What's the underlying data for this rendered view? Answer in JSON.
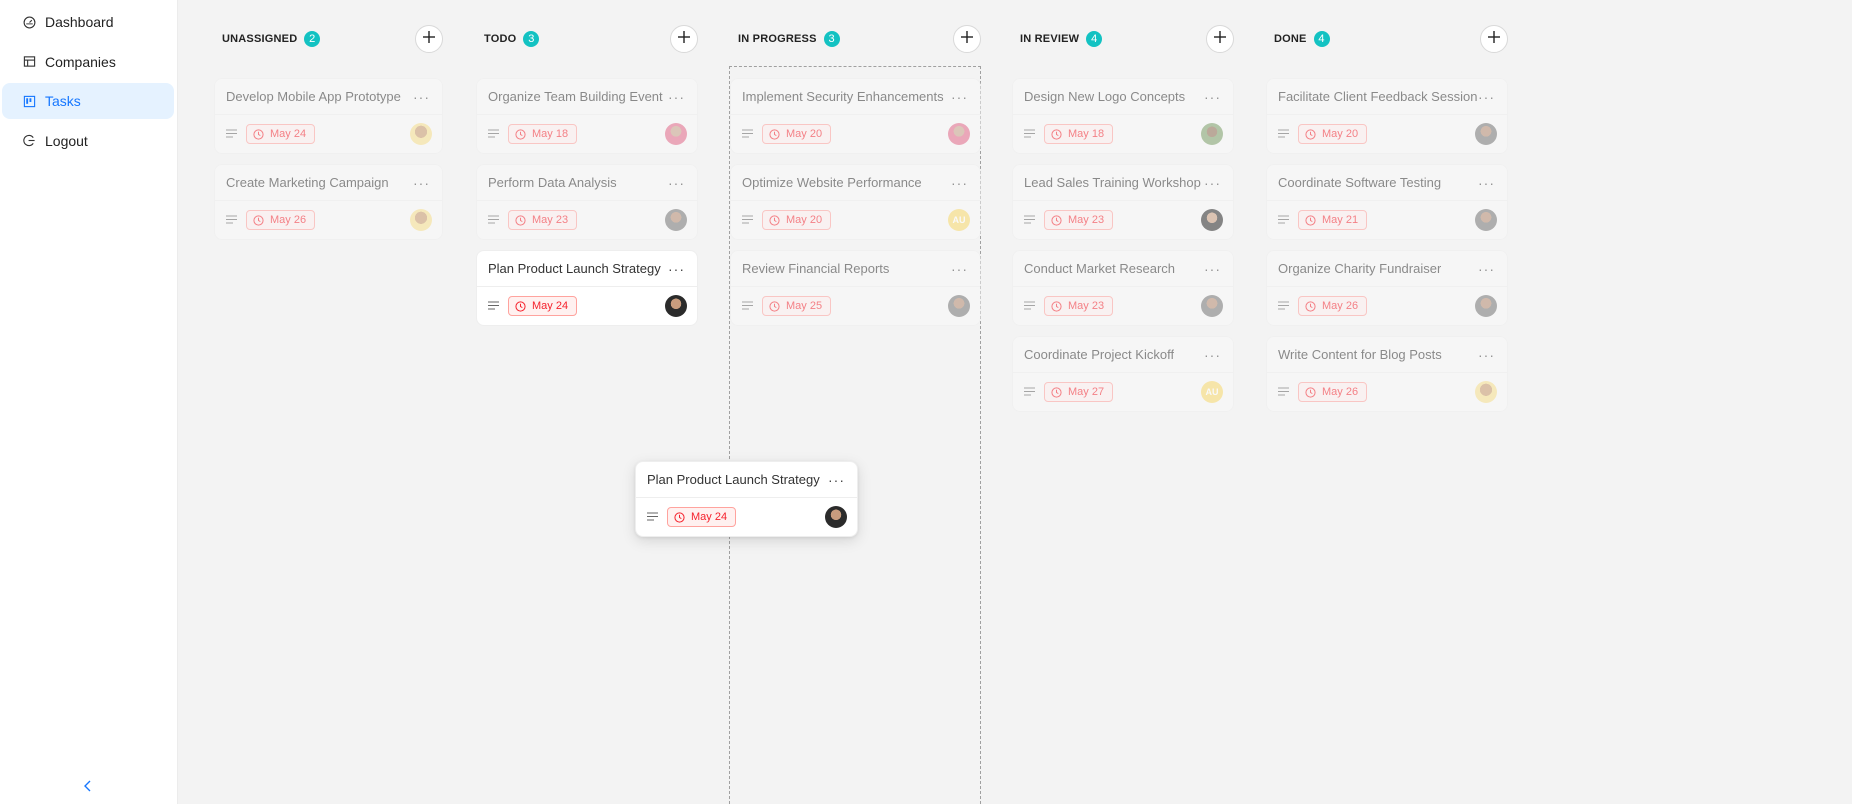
{
  "sidebar": {
    "items": [
      {
        "label": "Dashboard",
        "icon": "dashboard-icon",
        "active": false
      },
      {
        "label": "Companies",
        "icon": "shop-icon",
        "active": false
      },
      {
        "label": "Tasks",
        "icon": "project-board-icon",
        "active": true
      },
      {
        "label": "Logout",
        "icon": "logout-icon",
        "active": false
      }
    ],
    "collapse_icon": "chevron-left-icon"
  },
  "colors": {
    "accent": "#1677ff",
    "count_badge": "#13c2c2",
    "due_date": "#f5222d"
  },
  "columns": [
    {
      "title": "UNASSIGNED",
      "count": "2",
      "cards": [
        {
          "title": "Develop Mobile App Prototype",
          "date": "May 24",
          "avatar": "yellow-photo"
        },
        {
          "title": "Create Marketing Campaign",
          "date": "May 26",
          "avatar": "yellow-photo"
        }
      ]
    },
    {
      "title": "TODO",
      "count": "3",
      "cards": [
        {
          "title": "Organize Team Building Event",
          "date": "May 18",
          "avatar": "pink-photo"
        },
        {
          "title": "Perform Data Analysis",
          "date": "May 23",
          "avatar": "gray-photo"
        },
        {
          "title": "Plan Product Launch Strategy",
          "date": "May 24",
          "avatar": "dark-photo"
        }
      ]
    },
    {
      "title": "IN PROGRESS",
      "count": "3",
      "cards": [
        {
          "title": "Implement Security Enhancements",
          "date": "May 20",
          "avatar": "pink-photo"
        },
        {
          "title": "Optimize Website Performance",
          "date": "May 20",
          "avatar": "AU"
        },
        {
          "title": "Review Financial Reports",
          "date": "May 25",
          "avatar": "gray-photo"
        }
      ]
    },
    {
      "title": "IN REVIEW",
      "count": "4",
      "cards": [
        {
          "title": "Design New Logo Concepts",
          "date": "May 18",
          "avatar": "green-photo"
        },
        {
          "title": "Lead Sales Training Workshop",
          "date": "May 23",
          "avatar": "dark-photo"
        },
        {
          "title": "Conduct Market Research",
          "date": "May 23",
          "avatar": "gray-photo"
        },
        {
          "title": "Coordinate Project Kickoff",
          "date": "May 27",
          "avatar": "AU"
        }
      ]
    },
    {
      "title": "DONE",
      "count": "4",
      "cards": [
        {
          "title": "Facilitate Client Feedback Session",
          "date": "May 20",
          "avatar": "gray-photo"
        },
        {
          "title": "Coordinate Software Testing",
          "date": "May 21",
          "avatar": "gray-photo"
        },
        {
          "title": "Organize Charity Fundraiser",
          "date": "May 26",
          "avatar": "gray-photo"
        },
        {
          "title": "Write Content for Blog Posts",
          "date": "May 26",
          "avatar": "yellow-photo"
        }
      ]
    }
  ],
  "dragging_card": {
    "title": "Plan Product Launch Strategy",
    "date": "May 24",
    "avatar": "dark-photo"
  }
}
